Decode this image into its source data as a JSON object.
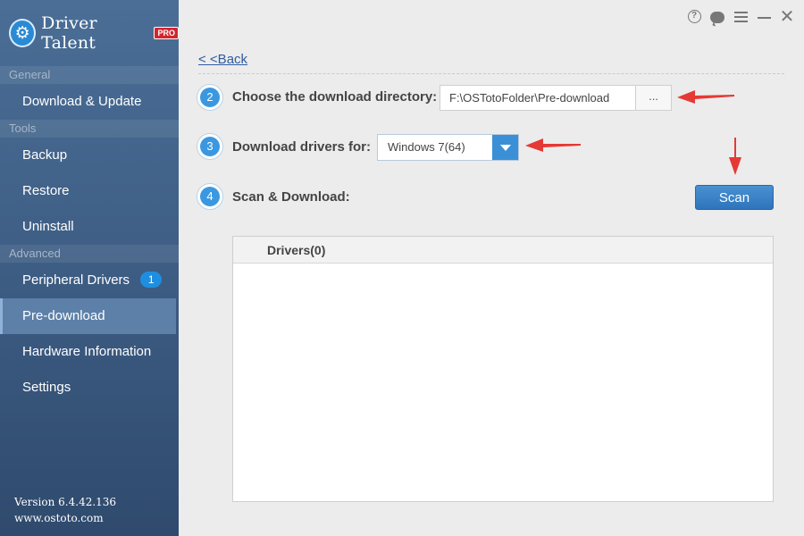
{
  "app": {
    "name": "Driver Talent",
    "edition": "PRO",
    "colors": {
      "sidebar": "#3f5f86",
      "accent": "#3b98e0",
      "annotation": "#e53935"
    }
  },
  "sidebar": {
    "sections": [
      {
        "title": "General",
        "items": [
          {
            "label": "Download & Update"
          }
        ]
      },
      {
        "title": "Tools",
        "items": [
          {
            "label": "Backup"
          },
          {
            "label": "Restore"
          },
          {
            "label": "Uninstall"
          }
        ]
      },
      {
        "title": "Advanced",
        "items": [
          {
            "label": "Peripheral Drivers",
            "badge": "1"
          },
          {
            "label": "Pre-download",
            "active": true
          },
          {
            "label": "Hardware Information"
          },
          {
            "label": "Settings"
          }
        ]
      }
    ],
    "version": "Version 6.4.42.136",
    "website": "www.ostoto.com"
  },
  "window_controls": [
    "help-icon",
    "feedback-icon",
    "menu-icon",
    "minimize-icon",
    "close-icon"
  ],
  "main": {
    "back_label": "< <Back",
    "steps": [
      {
        "number": "2",
        "label": "Choose the download directory:"
      },
      {
        "number": "3",
        "label": "Download drivers for:"
      },
      {
        "number": "4",
        "label": "Scan & Download:"
      }
    ],
    "directory_value": "F:\\OSTotoFolder\\Pre-download",
    "browse_label": "...",
    "os_selected": "Windows 7(64)",
    "scan_label": "Scan",
    "drivers_header": "Drivers(0)"
  }
}
